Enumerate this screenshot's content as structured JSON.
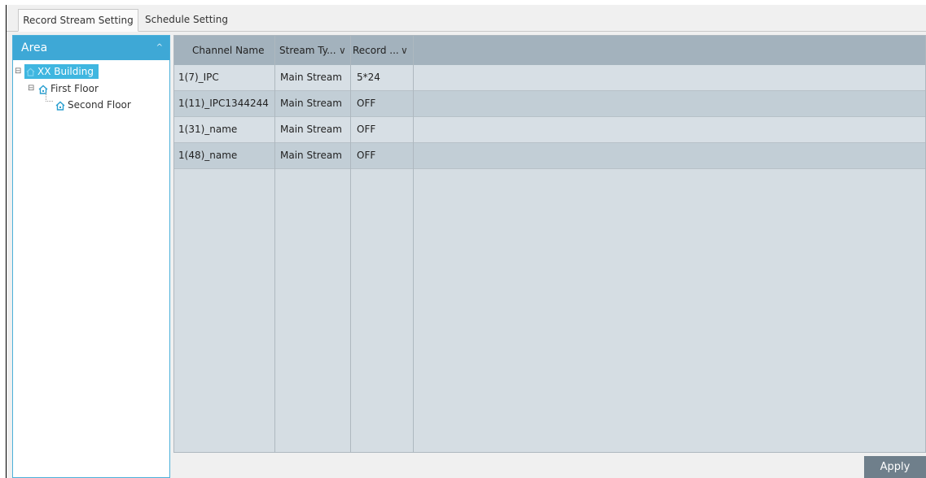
{
  "tabs": [
    {
      "label": "Record Stream Setting",
      "active": true
    },
    {
      "label": "Schedule Setting",
      "active": false
    }
  ],
  "area_panel": {
    "title": "Area",
    "collapse_icon": "chevron-up-icon",
    "tree": [
      {
        "label": "XX Building",
        "level": 0,
        "expander": "⊟",
        "icon": "house-icon",
        "selected": true
      },
      {
        "label": "First Floor",
        "level": 1,
        "expander": "⊟",
        "icon": "house-icon",
        "selected": false
      },
      {
        "label": "Second Floor",
        "level": 2,
        "expander": "",
        "icon": "house-icon",
        "selected": false
      }
    ]
  },
  "table": {
    "columns": [
      "Channel Name",
      "Stream Ty...",
      "Record ..."
    ],
    "column_dropdown_icon": "chevron-down-icon",
    "rows": [
      {
        "channel": "1(7)_IPC",
        "stream": "Main Stream",
        "record": "5*24"
      },
      {
        "channel": "1(11)_IPC1344244",
        "stream": "Main Stream",
        "record": "OFF"
      },
      {
        "channel": "1(31)_name",
        "stream": "Main Stream",
        "record": "OFF"
      },
      {
        "channel": "1(48)_name",
        "stream": "Main Stream",
        "record": "OFF"
      }
    ]
  },
  "apply_label": "Apply",
  "colors": {
    "accent": "#3ea8d6",
    "header_bg": "#a3b2bd",
    "row_light": "#d7dfe5",
    "row_dark": "#c2ced6",
    "button_bg": "#6f7f8b"
  }
}
